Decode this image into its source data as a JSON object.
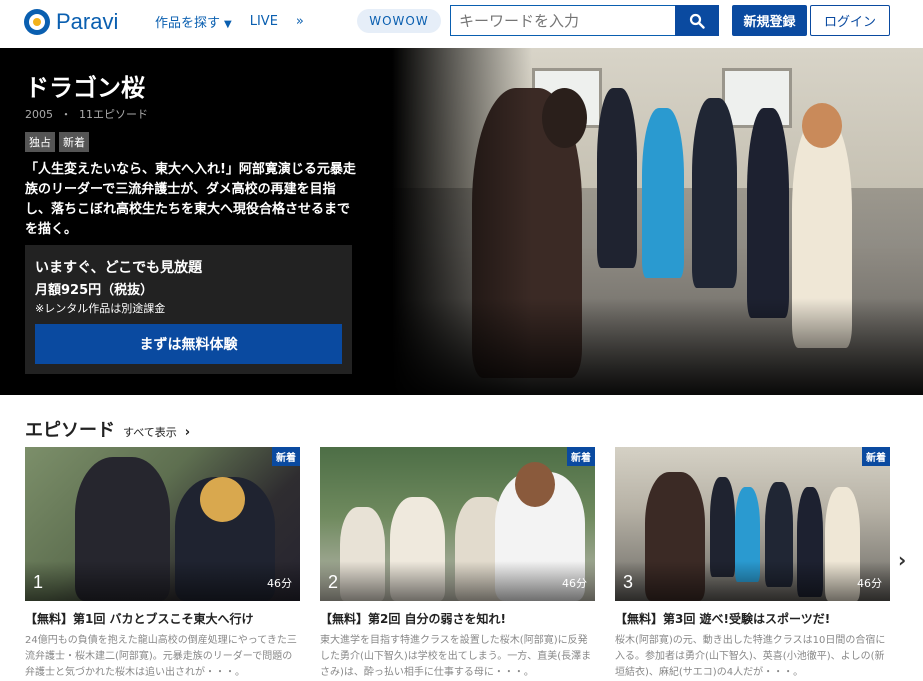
{
  "header": {
    "logo_text": "Paravi",
    "nav": [
      {
        "label": "作品を探す",
        "has_dropdown": true
      },
      {
        "label": "LIVE"
      },
      {
        "label": "»"
      }
    ],
    "wowow_label": "WOWOW",
    "search_placeholder": "キーワードを入力",
    "signup_label": "新規登録",
    "login_label": "ログイン",
    "accent_color": "#0a4aa0"
  },
  "hero": {
    "title": "ドラゴン桜",
    "year": "2005",
    "separator": "・",
    "episodes": "11エピソード",
    "badges": [
      "独占",
      "新着"
    ],
    "description": "「人生変えたいなら、東大へ入れ!」阿部寛演じる元暴走族のリーダーで三流弁護士が、ダメ高校の再建を目指し、落ちこぼれ高校生たちを東大へ現役合格させるまでを描く。",
    "plan": {
      "title": "いますぐ、どこでも見放題",
      "price": "月額925円（税抜）",
      "note": "※レンタル作品は別途課金",
      "cta": "まずは無料体験"
    }
  },
  "episodes_section": {
    "heading": "エピソード",
    "view_all": "すべて表示",
    "items": [
      {
        "number": "1",
        "duration": "46分",
        "tag": "新着",
        "title": "【無料】第1回 バカとブスこそ東大へ行け",
        "description": "24億円もの負債を抱えた龍山高校の倒産処理にやってきた三流弁護士・桜木建二(阿部寛)。元暴走族のリーダーで問題の弁護士と気づかれた桜木は追い出されが・・・。"
      },
      {
        "number": "2",
        "duration": "46分",
        "tag": "新着",
        "title": "【無料】第2回 自分の弱さを知れ!",
        "description": "東大進学を目指す特進クラスを設置した桜木(阿部寛)に反発した勇介(山下智久)は学校を出てしまう。一方、直美(長澤まさみ)は、酔っ払い相手に仕事する母に・・・。"
      },
      {
        "number": "3",
        "duration": "46分",
        "tag": "新着",
        "title": "【無料】第3回 遊べ!受験はスポーツだ!",
        "description": "桜木(阿部寛)の元、動き出した特進クラスは10日間の合宿に入る。参加者は勇介(山下智久)、英喜(小池徹平)、よしの(新垣結衣)、麻紀(サエコ)の4人だが・・・。"
      }
    ]
  }
}
